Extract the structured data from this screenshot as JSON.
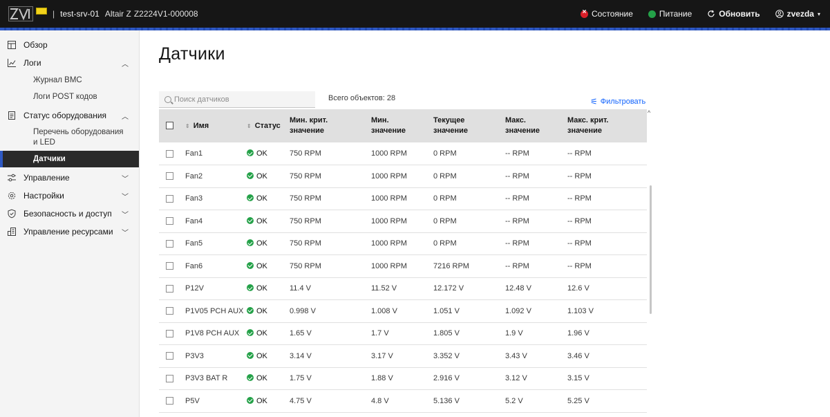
{
  "header": {
    "hostname": "test-srv-01",
    "model": "Altair Z",
    "serial": "Z2224V1-000008",
    "actions": {
      "state": "Состояние",
      "power": "Питание",
      "refresh": "Обновить",
      "user": "zvezda"
    }
  },
  "sidebar": {
    "overview": "Обзор",
    "logs": "Логи",
    "logs_items": [
      "Журнал BMC",
      "Логи POST кодов"
    ],
    "hw_status": "Статус оборудования",
    "hw_items": [
      "Перечень оборудования и LED",
      "Датчики"
    ],
    "control": "Управление",
    "settings": "Настройки",
    "security": "Безопасность и доступ",
    "resources": "Управление ресурсами"
  },
  "page": {
    "title": "Датчики",
    "search_placeholder": "Поиск датчиков",
    "total": "Всего объектов: 28",
    "filter": "Фильтровать"
  },
  "table": {
    "headers": {
      "name": "Имя",
      "status": "Статус",
      "min_crit": "Мин. крит. значение",
      "min": "Мин. значение",
      "current": "Текущее значение",
      "max": "Макс. значение",
      "max_crit": "Макс. крит. значение"
    },
    "rows": [
      {
        "name": "Fan1",
        "status": "OK",
        "min_crit": "750 RPM",
        "min": "1000 RPM",
        "current": "0 RPM",
        "max": "-- RPM",
        "max_crit": "-- RPM"
      },
      {
        "name": "Fan2",
        "status": "OK",
        "min_crit": "750 RPM",
        "min": "1000 RPM",
        "current": "0 RPM",
        "max": "-- RPM",
        "max_crit": "-- RPM"
      },
      {
        "name": "Fan3",
        "status": "OK",
        "min_crit": "750 RPM",
        "min": "1000 RPM",
        "current": "0 RPM",
        "max": "-- RPM",
        "max_crit": "-- RPM"
      },
      {
        "name": "Fan4",
        "status": "OK",
        "min_crit": "750 RPM",
        "min": "1000 RPM",
        "current": "0 RPM",
        "max": "-- RPM",
        "max_crit": "-- RPM"
      },
      {
        "name": "Fan5",
        "status": "OK",
        "min_crit": "750 RPM",
        "min": "1000 RPM",
        "current": "0 RPM",
        "max": "-- RPM",
        "max_crit": "-- RPM"
      },
      {
        "name": "Fan6",
        "status": "OK",
        "min_crit": "750 RPM",
        "min": "1000 RPM",
        "current": "7216 RPM",
        "max": "-- RPM",
        "max_crit": "-- RPM"
      },
      {
        "name": "P12V",
        "status": "OK",
        "min_crit": "11.4 V",
        "min": "11.52 V",
        "current": "12.172 V",
        "max": "12.48 V",
        "max_crit": "12.6 V"
      },
      {
        "name": "P1V05 PCH AUX",
        "status": "OK",
        "min_crit": "0.998 V",
        "min": "1.008 V",
        "current": "1.051 V",
        "max": "1.092 V",
        "max_crit": "1.103 V"
      },
      {
        "name": "P1V8 PCH AUX",
        "status": "OK",
        "min_crit": "1.65 V",
        "min": "1.7 V",
        "current": "1.805 V",
        "max": "1.9 V",
        "max_crit": "1.96 V"
      },
      {
        "name": "P3V3",
        "status": "OK",
        "min_crit": "3.14 V",
        "min": "3.17 V",
        "current": "3.352 V",
        "max": "3.43 V",
        "max_crit": "3.46 V"
      },
      {
        "name": "P3V3 BAT R",
        "status": "OK",
        "min_crit": "1.75 V",
        "min": "1.88 V",
        "current": "2.916 V",
        "max": "3.12 V",
        "max_crit": "3.15 V"
      },
      {
        "name": "P5V",
        "status": "OK",
        "min_crit": "4.75 V",
        "min": "4.8 V",
        "current": "5.136 V",
        "max": "5.2 V",
        "max_crit": "5.25 V"
      }
    ]
  },
  "colors": {
    "header_bg": "#161616",
    "accent": "#2f59c3",
    "ok": "#24a148",
    "error": "#da1e28",
    "link": "#0f62fe"
  }
}
